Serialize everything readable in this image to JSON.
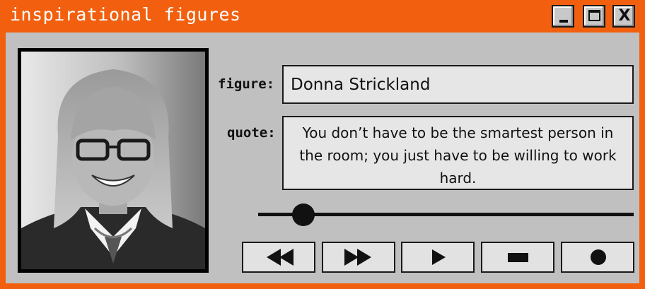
{
  "window": {
    "title": "inspirational figures",
    "controls": {
      "minimize_icon": "minimize-icon",
      "maximize_icon": "maximize-icon",
      "close_icon": "close-icon",
      "close_glyph": "X"
    }
  },
  "profile": {
    "figure_label": "figure:",
    "figure_value": "Donna Strickland",
    "quote_label": "quote:",
    "quote_value": "You don’t have to be the smartest person in the room; you just have to be willing to work hard."
  },
  "player": {
    "progress": 0.12,
    "controls": [
      {
        "name": "rewind-button",
        "icon": "rewind-icon"
      },
      {
        "name": "fast-forward-button",
        "icon": "fast-forward-icon"
      },
      {
        "name": "play-button",
        "icon": "play-icon"
      },
      {
        "name": "stop-button",
        "icon": "stop-icon"
      },
      {
        "name": "record-button",
        "icon": "record-icon"
      }
    ]
  },
  "colors": {
    "frame": "#f2600f",
    "panel": "#c0c0c0",
    "field": "#e6e6e6",
    "ink": "#111111"
  }
}
